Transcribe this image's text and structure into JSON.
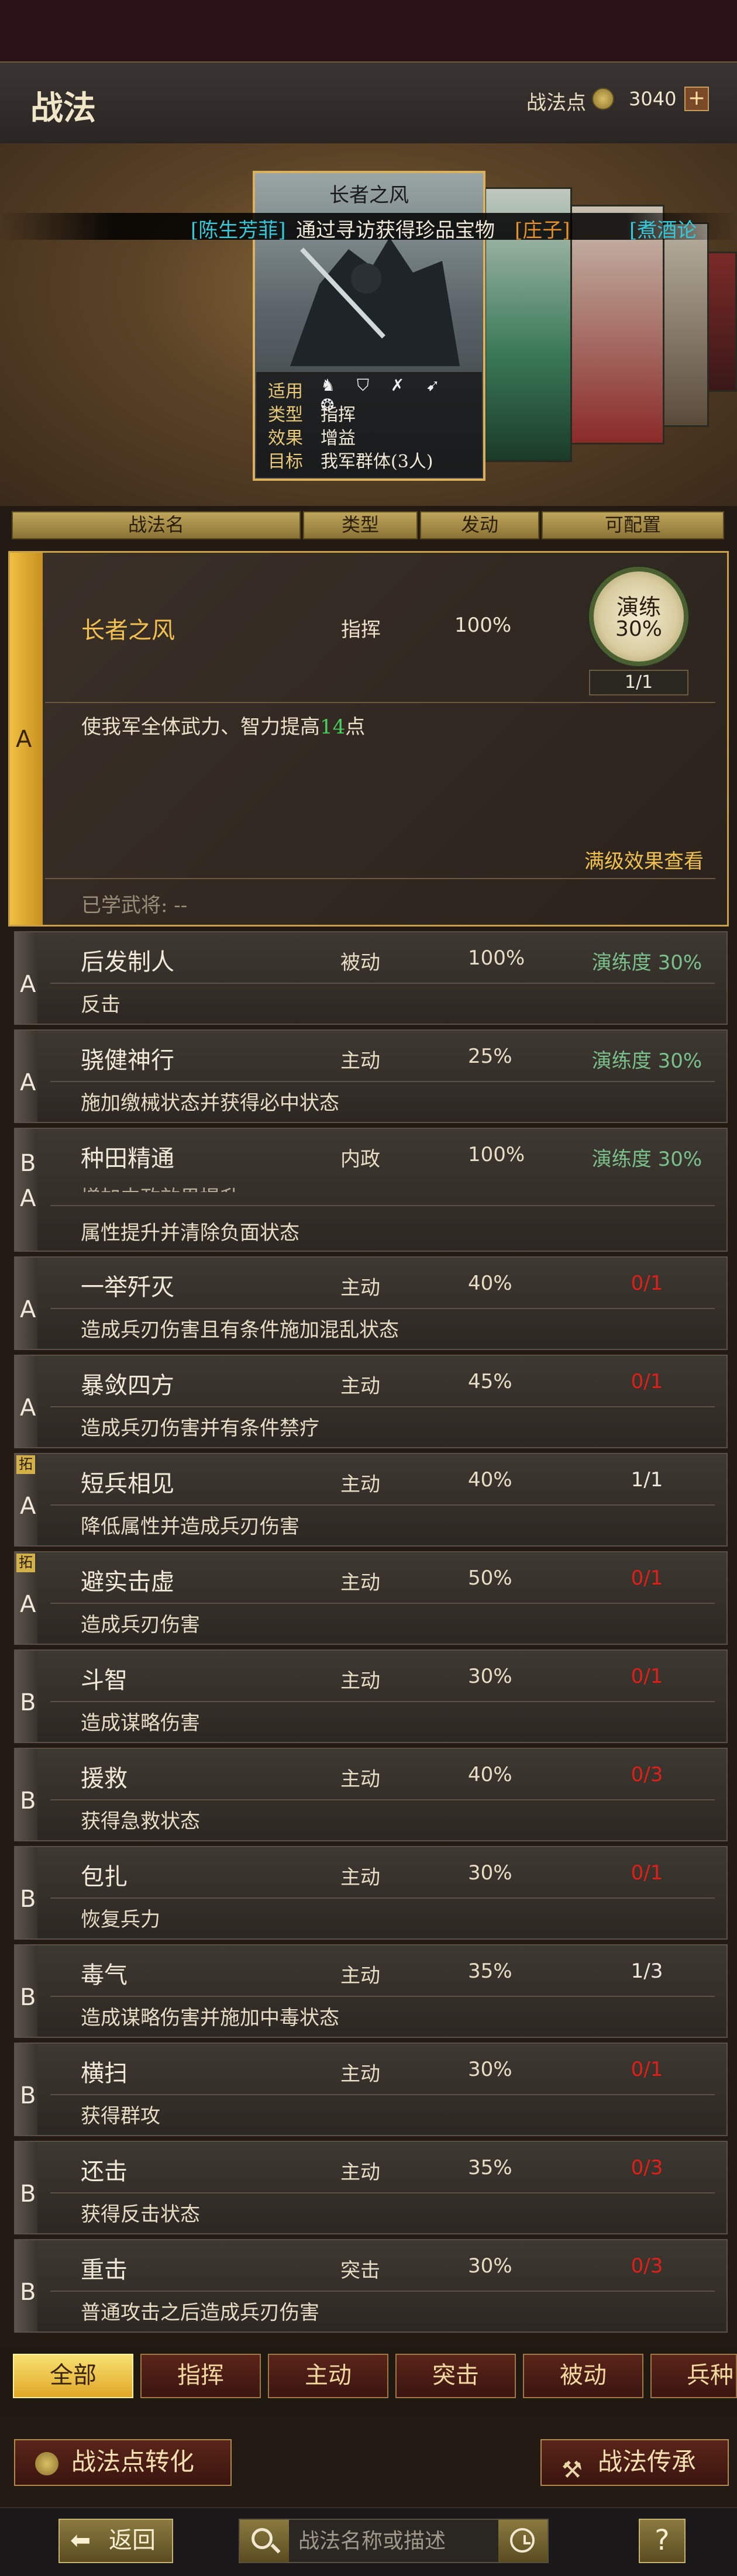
{
  "header": {
    "title": "战法",
    "points_label": "战法点",
    "points_value": "3040",
    "add_label": "+"
  },
  "banner": {
    "seg1": "[陈生芳菲]",
    "seg2": "通过寻访获得珍品宝物",
    "seg3": "[庄子]",
    "seg4": "[煮酒论"
  },
  "featured_card": {
    "title": "长者之风",
    "rows": [
      {
        "label": "适用",
        "value": ""
      },
      {
        "label": "类型",
        "value": "指挥"
      },
      {
        "label": "效果",
        "value": "增益"
      },
      {
        "label": "目标",
        "value": "我军群体(3人)"
      }
    ],
    "unit_icons": "♞ ⛉ ✗ ➹ ❂"
  },
  "columns": {
    "name": "战法名",
    "type": "类型",
    "rate": "发动",
    "config": "可配置"
  },
  "expanded": {
    "grade": "A",
    "name": "长者之风",
    "type": "指挥",
    "rate": "100%",
    "drill_label": "演练",
    "drill_pct": "30%",
    "drill_count": "1/1",
    "desc_prefix": "使我军全体武力、智力提高",
    "desc_value": "14",
    "desc_suffix": "点",
    "full_effect_link": "满级效果查看",
    "learned_label": "已学武将: --"
  },
  "rows": [
    {
      "grade": "A",
      "name": "后发制人",
      "type": "被动",
      "rate": "100%",
      "status": "演练度 30%",
      "desc": "反击"
    },
    {
      "grade": "A",
      "name": "骁健神行",
      "type": "主动",
      "rate": "25%",
      "status": "演练度 30%",
      "desc": "施加缴械状态并获得必中状态"
    },
    {
      "grade": "B",
      "grade2": "A",
      "name": "种田精通",
      "type": "内政",
      "rate": "100%",
      "status": "演练度 30%",
      "desc_cut": "增加内政效果提升",
      "desc": "属性提升并清除负面状态"
    },
    {
      "grade": "A",
      "name": "一举歼灭",
      "type": "主动",
      "rate": "40%",
      "status": "0/1",
      "desc": "造成兵刃伤害且有条件施加混乱状态"
    },
    {
      "grade": "A",
      "name": "暴敛四方",
      "type": "主动",
      "rate": "45%",
      "status": "0/1",
      "desc": "造成兵刃伤害并有条件禁疗"
    },
    {
      "grade": "A",
      "tag": "拓",
      "name": "短兵相见",
      "type": "主动",
      "rate": "40%",
      "status": "1/1",
      "desc": "降低属性并造成兵刃伤害"
    },
    {
      "grade": "A",
      "tag": "拓",
      "name": "避实击虚",
      "type": "主动",
      "rate": "50%",
      "status": "0/1",
      "desc": "造成兵刃伤害"
    },
    {
      "grade": "B",
      "name": "斗智",
      "type": "主动",
      "rate": "30%",
      "status": "0/1",
      "desc": "造成谋略伤害"
    },
    {
      "grade": "B",
      "name": "援救",
      "type": "主动",
      "rate": "40%",
      "status": "0/3",
      "desc": "获得急救状态"
    },
    {
      "grade": "B",
      "name": "包扎",
      "type": "主动",
      "rate": "30%",
      "status": "0/1",
      "desc": "恢复兵力"
    },
    {
      "grade": "B",
      "name": "毒气",
      "type": "主动",
      "rate": "35%",
      "status": "1/3",
      "desc": "造成谋略伤害并施加中毒状态"
    },
    {
      "grade": "B",
      "name": "横扫",
      "type": "主动",
      "rate": "30%",
      "status": "0/1",
      "desc": "获得群攻"
    },
    {
      "grade": "B",
      "name": "还击",
      "type": "主动",
      "rate": "35%",
      "status": "0/3",
      "desc": "获得反击状态"
    },
    {
      "grade": "B",
      "name": "重击",
      "type": "突击",
      "rate": "30%",
      "status": "0/3",
      "desc": "普通攻击之后造成兵刃伤害"
    }
  ],
  "filter_tabs": [
    "全部",
    "指挥",
    "主动",
    "突击",
    "被动",
    "兵种"
  ],
  "actions": {
    "convert": "战法点转化",
    "inherit": "战法传承"
  },
  "bottom": {
    "back": "返回",
    "back_arrow": "⬅",
    "search_placeholder": "战法名称或描述",
    "help": "?"
  },
  "colors": {
    "accent_gold": "#f0c050",
    "drill_green": "#7ac08a",
    "status_red": "#e02018",
    "banner_cyan": "#35c8d8",
    "banner_orange": "#e89028"
  }
}
